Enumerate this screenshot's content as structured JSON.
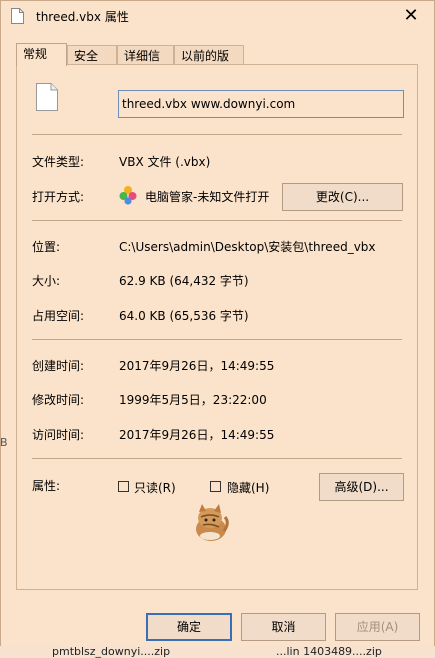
{
  "window": {
    "title": "threed.vbx 属性"
  },
  "tabs": [
    {
      "label": "常规",
      "active": true
    },
    {
      "label": "安全",
      "active": false
    },
    {
      "label": "详细信息",
      "active": false
    },
    {
      "label": "以前的版本",
      "active": false
    }
  ],
  "general": {
    "filename": "threed.vbx www.downyi.com",
    "type_label": "文件类型:",
    "type_value": "VBX 文件 (.vbx)",
    "open_with_label": "打开方式:",
    "open_with_value": "电脑管家-未知文件打开",
    "change_button": "更改(C)...",
    "location_label": "位置:",
    "location_value": "C:\\Users\\admin\\Desktop\\安装包\\threed_vbx",
    "size_label": "大小:",
    "size_value": "62.9 KB (64,432 字节)",
    "disk_size_label": "占用空间:",
    "disk_size_value": "64.0 KB (65,536 字节)",
    "created_label": "创建时间:",
    "created_value": "2017年9月26日，14:49:55",
    "modified_label": "修改时间:",
    "modified_value": "1999年5月5日，23:22:00",
    "accessed_label": "访问时间:",
    "accessed_value": "2017年9月26日，14:49:55",
    "attributes_label": "属性:",
    "readonly_label": "只读(R)",
    "readonly_checked": false,
    "hidden_label": "隐藏(H)",
    "hidden_checked": false,
    "advanced_button": "高级(D)..."
  },
  "footer": {
    "ok": "确定",
    "cancel": "取消",
    "apply": "应用(A)"
  },
  "background": {
    "taskbar_left": "pmtblsz_downyi....zip",
    "taskbar_right": "...lin 1403489....zip",
    "side_fragment": "B"
  },
  "colors": {
    "window_bg": "#fbe3cb",
    "accent": "#3b6fb5"
  },
  "icons": {
    "file": "file-icon",
    "close": "close-icon",
    "app": "pc-manager-icon",
    "pet": "cat-icon"
  }
}
